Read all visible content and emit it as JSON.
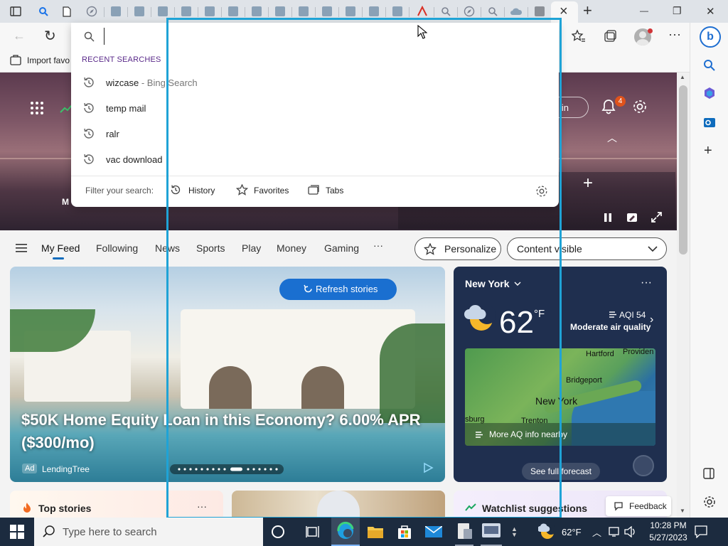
{
  "tabs": {
    "count_visible": 24,
    "active_close_label": "×",
    "new_tab_label": "+"
  },
  "window": {
    "minimize": "—",
    "restore": "❐",
    "close": "✕"
  },
  "toolbar": {
    "back": "←",
    "refresh": "↻",
    "address_value": ""
  },
  "favorites_bar": {
    "import_label": "Import favo"
  },
  "search_dropdown": {
    "section_title": "RECENT SEARCHES",
    "recent": [
      {
        "text": "wizcase",
        "suffix": " - Bing Search"
      },
      {
        "text": "temp mail",
        "suffix": ""
      },
      {
        "text": "ralr",
        "suffix": ""
      },
      {
        "text": "vac download",
        "suffix": ""
      }
    ],
    "filter_label": "Filter your search:",
    "filters": [
      "History",
      "Favorites",
      "Tabs"
    ]
  },
  "hero": {
    "sign_in": "n in",
    "notification_count": "4",
    "left_label": "M"
  },
  "feed_nav": {
    "items": [
      "My Feed",
      "Following",
      "News",
      "Sports",
      "Play",
      "Money",
      "Gaming"
    ],
    "more": "···",
    "personalize": "Personalize",
    "content_select": "Content visible"
  },
  "big_card": {
    "refresh": "Refresh stories",
    "headline": "$50K Home Equity Loan in this Economy? 6.00% APR ($300/mo)",
    "ad_badge": "Ad",
    "sponsor": "LendingTree"
  },
  "weather": {
    "city": "New York",
    "more": "···",
    "temp": "62",
    "unit": "°F",
    "aqi": "AQI 54",
    "aqi_desc": "Moderate air quality",
    "map_labels": [
      "Hartford",
      "Providen",
      "Bridgeport",
      "New York",
      "sburg",
      "Trenton"
    ],
    "more_aq": "More AQ info nearby",
    "forecast": "See full forecast"
  },
  "bottom_row": {
    "top_stories": "Top stories",
    "top_more": "···",
    "watchlist": "Watchlist suggestions",
    "feedback": "Feedback"
  },
  "taskbar": {
    "search_placeholder": "Type here to search",
    "temp": "62°F",
    "time": "10:28 PM",
    "date": "5/27/2023"
  },
  "colors": {
    "accent": "#0f6cbd",
    "highlight": "#1fa3d6",
    "taskbar": "#1c2b3f",
    "weather_bg": "#1f2f4f"
  }
}
